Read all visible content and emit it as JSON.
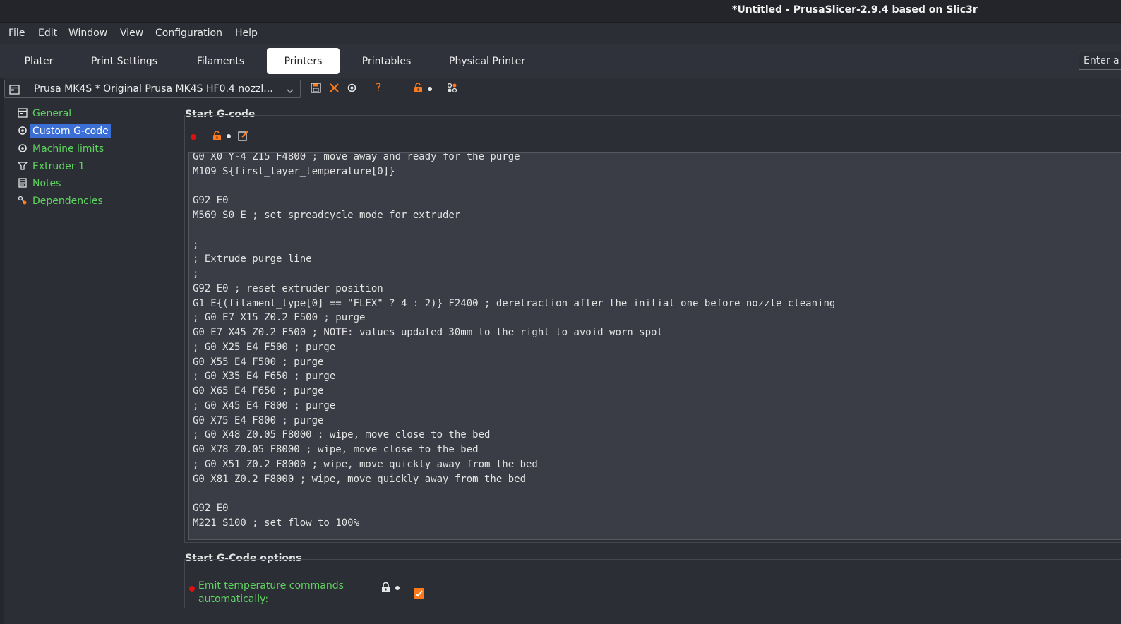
{
  "window": {
    "title": "*Untitled - PrusaSlicer-2.9.4 based on Slic3r"
  },
  "menu": [
    "File",
    "Edit",
    "Window",
    "View",
    "Configuration",
    "Help"
  ],
  "tabs": [
    {
      "label": "Plater",
      "active": false
    },
    {
      "label": "Print Settings",
      "active": false
    },
    {
      "label": "Filaments",
      "active": false
    },
    {
      "label": "Printers",
      "active": true
    },
    {
      "label": "Printables",
      "active": false
    },
    {
      "label": "Physical Printer",
      "active": false
    }
  ],
  "search": {
    "placeholder": "Enter a"
  },
  "preset": {
    "value": "Prusa MK4S * Original Prusa MK4S HF0.4 nozzl..."
  },
  "tree": [
    {
      "label": "General",
      "icon": "general-icon",
      "selected": false
    },
    {
      "label": "Custom G-code",
      "icon": "gear-icon",
      "selected": true
    },
    {
      "label": "Machine limits",
      "icon": "gear-icon",
      "selected": false
    },
    {
      "label": "Extruder 1",
      "icon": "funnel-icon",
      "selected": false
    },
    {
      "label": "Notes",
      "icon": "note-icon",
      "selected": false
    },
    {
      "label": "Dependencies",
      "icon": "wrench-icon",
      "selected": false
    }
  ],
  "start_gcode": {
    "title": "Start G-code",
    "lines": [
      "G0 X0 Y-4 Z15 F4800 ; move away and ready for the purge",
      "M109 S{first_layer_temperature[0]}",
      "",
      "G92 E0",
      "M569 S0 E ; set spreadcycle mode for extruder",
      "",
      ";",
      "; Extrude purge line",
      ";",
      "G92 E0 ; reset extruder position",
      "G1 E{(filament_type[0] == \"FLEX\" ? 4 : 2)} F2400 ; deretraction after the initial one before nozzle cleaning",
      "; G0 E7 X15 Z0.2 F500 ; purge",
      "G0 E7 X45 Z0.2 F500 ; NOTE: values updated 30mm to the right to avoid worn spot",
      "; G0 X25 E4 F500 ; purge",
      "G0 X55 E4 F500 ; purge",
      "; G0 X35 E4 F650 ; purge",
      "G0 X65 E4 F650 ; purge",
      "; G0 X45 E4 F800 ; purge",
      "G0 X75 E4 F800 ; purge",
      "; G0 X48 Z0.05 F8000 ; wipe, move close to the bed",
      "G0 X78 Z0.05 F8000 ; wipe, move close to the bed",
      "; G0 X51 Z0.2 F8000 ; wipe, move quickly away from the bed",
      "G0 X81 Z0.2 F8000 ; wipe, move quickly away from the bed",
      "",
      "G92 E0",
      "M221 S100 ; set flow to 100%"
    ]
  },
  "start_gcode_options": {
    "title": "Start G-Code options",
    "emit_temp_label": "Emit temperature commands automatically:",
    "emit_temp_checked": true
  },
  "colors": {
    "accent": "#ff7a1a",
    "modified_label": "#5fd35f",
    "selection": "#3b6fd6",
    "modified_dot": "#e01010"
  }
}
